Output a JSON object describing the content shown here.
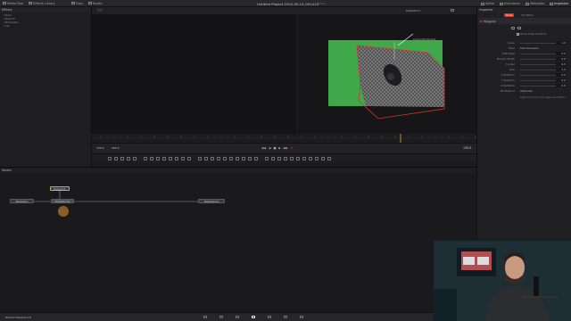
{
  "topbar": {
    "media_pool": "Media Pool",
    "effects_library": "Effects Library",
    "clips": "Clips",
    "nodes": "Nodes",
    "project_title": "Untitled Project 2020-05-19_091419",
    "edited": "Edited",
    "spline": "Spline",
    "keyframes": "Keyframes",
    "metadata": "Metadata",
    "inspector": "Inspector"
  },
  "effects": {
    "title": "Effects",
    "tree": [
      "Tools",
      "OpenFX",
      "Templates",
      "Lua"
    ]
  },
  "viewer": {
    "title": "MediaOut1",
    "resolution": "1920x1080xfloat32",
    "zoom": "Fit",
    "frame_start": "130.0",
    "frame_end": "200.0",
    "current_frame": "135.0"
  },
  "nodes": {
    "title": "Nodes",
    "items": [
      "MediaIn1",
      "Polygon1",
      "MediaOut1",
      "Transform1"
    ]
  },
  "inspector": {
    "title": "Inspector",
    "tabs": [
      "Tools",
      "Modifiers"
    ],
    "tool": "Polygon1",
    "show_view_controls": "Show View Controls",
    "fields": [
      {
        "label": "Level",
        "value": "1.0"
      },
      {
        "label": "Filter",
        "value": "Fast Gaussian"
      },
      {
        "label": "Soft Edge",
        "value": "0.0"
      },
      {
        "label": "Border Width",
        "value": "0.0"
      },
      {
        "label": "Center",
        "value": "0.5"
      },
      {
        "label": "Size",
        "value": "1.0"
      },
      {
        "label": "X Rotation",
        "value": "0.0"
      },
      {
        "label": "Y Rotation",
        "value": "0.0"
      },
      {
        "label": "Z Rotation",
        "value": "0.0"
      },
      {
        "label": "Fill Method",
        "value": "Alternate"
      }
    ],
    "hint": "Right-click here for shape animation"
  },
  "pagebar": {
    "app": "DaVinci Resolve 16"
  },
  "colors": {
    "accent": "#e05b2a",
    "green_screen": "#3fa84a",
    "polygon": "#d8332b"
  }
}
